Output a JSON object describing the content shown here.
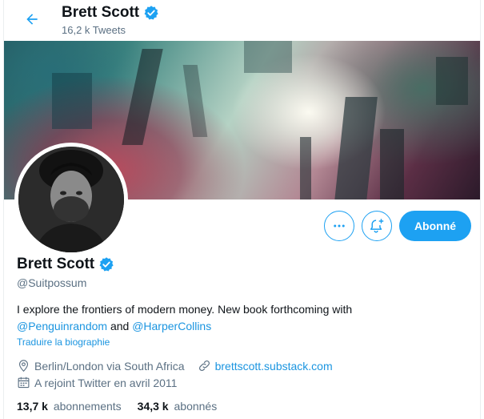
{
  "header": {
    "name": "Brett Scott",
    "tweet_count": "16,2 k Tweets"
  },
  "profile": {
    "name": "Brett Scott",
    "handle": "@Suitpossum",
    "bio_text": "I explore the frontiers of modern money. New book forthcoming with",
    "bio_mention_1": "@Penguinrandom",
    "bio_and": "and",
    "bio_mention_2": "@HarperCollins",
    "translate_label": "Traduire la biographie",
    "location": "Berlin/London via South Africa",
    "website": "brettscott.substack.com",
    "joined": "A rejoint Twitter en avril 2011"
  },
  "actions": {
    "more_label": "…",
    "follow_label": "Abonné"
  },
  "stats": {
    "following_count": "13,7 k",
    "following_label": "abonnements",
    "followers_count": "34,3 k",
    "followers_label": "abonnés"
  },
  "colors": {
    "accent": "#1da1f2",
    "link": "#1b95e0",
    "muted": "#5b7083"
  },
  "icons": {
    "back": "arrow-left-icon",
    "verified": "verified-badge-icon",
    "more": "more-dots-icon",
    "notify": "bell-plus-icon",
    "location": "location-pin-icon",
    "link": "link-icon",
    "calendar": "calendar-icon"
  }
}
